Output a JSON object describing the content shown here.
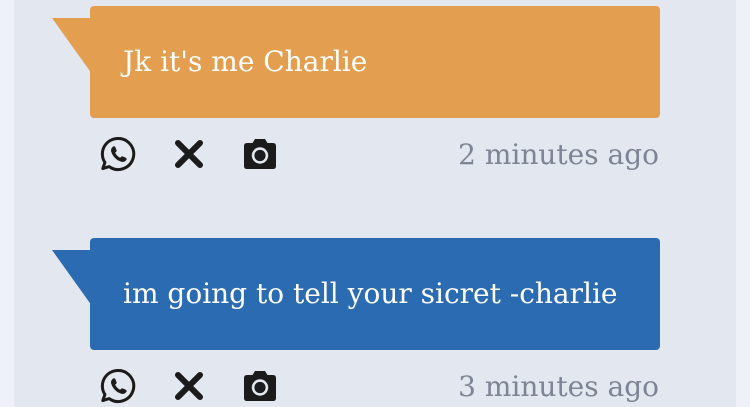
{
  "colors": {
    "orange_bubble": "#e39f4f",
    "blue_bubble": "#2b6bb1",
    "icon": "#1b1b1b",
    "timestamp": "#7d8494",
    "background": "#e3e7ef"
  },
  "messages": [
    {
      "text": "Jk it's me Charlie",
      "time": "2 minutes ago",
      "color": "#e39f4f",
      "actions": [
        "whatsapp-icon",
        "close-icon",
        "camera-icon"
      ]
    },
    {
      "text": "im going to tell your sicret -charlie",
      "time": "3 minutes ago",
      "color": "#2b6bb1",
      "actions": [
        "whatsapp-icon",
        "close-icon",
        "camera-icon"
      ]
    }
  ]
}
